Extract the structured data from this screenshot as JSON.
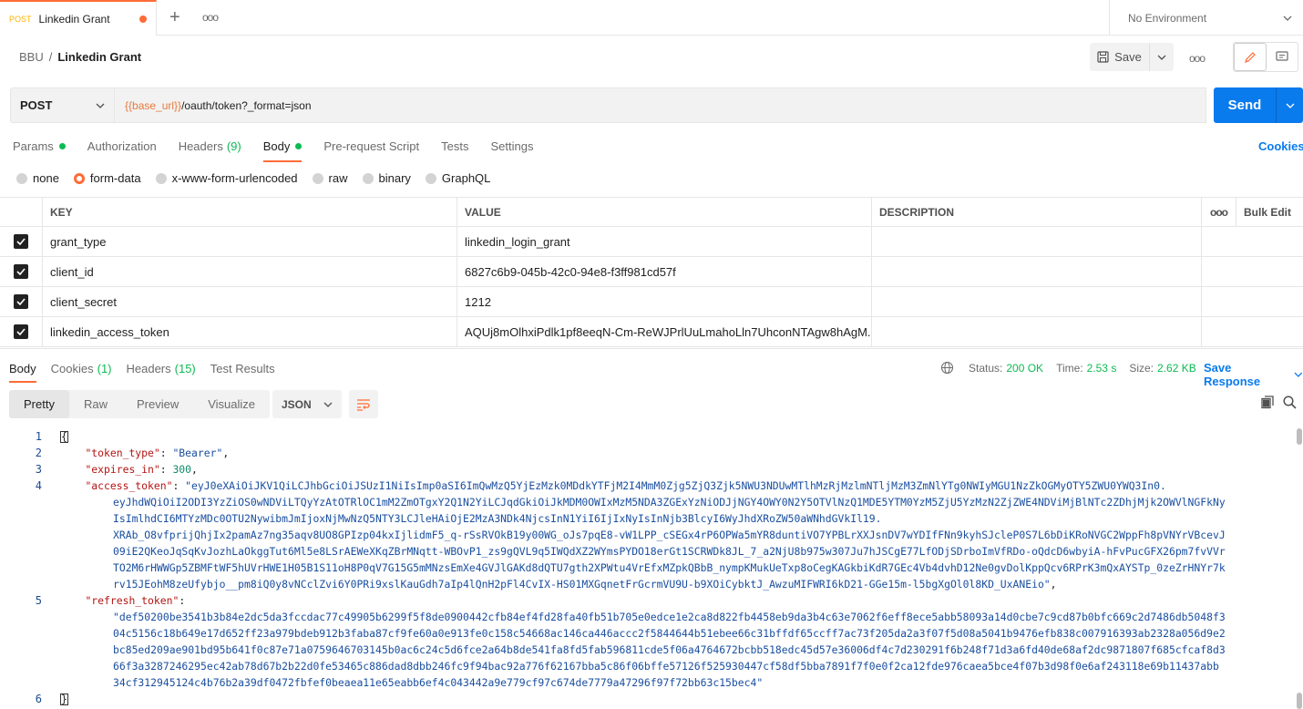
{
  "tab": {
    "method": "POST",
    "name": "Linkedin Grant",
    "unsaved": true
  },
  "environment": {
    "label": "No Environment"
  },
  "breadcrumb": {
    "collection": "BBU",
    "separator": "/",
    "request": "Linkedin Grant"
  },
  "toolbar": {
    "save_label": "Save"
  },
  "request": {
    "method": "POST",
    "url_var": "{{base_url}}",
    "url_path": "/oauth/token?_format=json",
    "send_label": "Send"
  },
  "req_tabs": {
    "params": "Params",
    "authorization": "Authorization",
    "headers": "Headers",
    "headers_count": "(9)",
    "body": "Body",
    "prerequest": "Pre-request Script",
    "tests": "Tests",
    "settings": "Settings",
    "cookies": "Cookies"
  },
  "body_types": {
    "none": "none",
    "form_data": "form-data",
    "urlencoded": "x-www-form-urlencoded",
    "raw": "raw",
    "binary": "binary",
    "graphql": "GraphQL",
    "selected": "form-data"
  },
  "table": {
    "headers": {
      "key": "KEY",
      "value": "VALUE",
      "description": "DESCRIPTION",
      "bulk_edit": "Bulk Edit"
    },
    "rows": [
      {
        "key": "grant_type",
        "value": "linkedin_login_grant",
        "checked": true
      },
      {
        "key": "client_id",
        "value": "6827c6b9-045b-42c0-94e8-f3ff981cd57f",
        "checked": true
      },
      {
        "key": "client_secret",
        "value": "1212",
        "checked": true
      },
      {
        "key": "linkedin_access_token",
        "value": "AQUj8mOlhxiPdlk1pf8eeqN-Cm-ReWJPrlUuLmahoLln7UhconNTAgw8hAgM...",
        "checked": true
      }
    ]
  },
  "response": {
    "tabs": {
      "body": "Body",
      "cookies": "Cookies",
      "cookies_count": "(1)",
      "headers": "Headers",
      "headers_count": "(15)",
      "test_results": "Test Results"
    },
    "status_label": "Status:",
    "status": "200 OK",
    "time_label": "Time:",
    "time": "2.53 s",
    "size_label": "Size:",
    "size": "2.62 KB",
    "save_response": "Save Response",
    "view_modes": {
      "pretty": "Pretty",
      "raw": "Raw",
      "preview": "Preview",
      "visualize": "Visualize"
    },
    "format": "JSON"
  },
  "code": {
    "line_numbers": [
      "1",
      "2",
      "3",
      "4",
      "5",
      "6"
    ],
    "open_brace": "{",
    "close_brace": "}",
    "token_type_key": "\"token_type\"",
    "token_type_val": "\"Bearer\"",
    "expires_in_key": "\"expires_in\"",
    "expires_in_val": "300",
    "access_token_key": "\"access_token\"",
    "access_token_lines": [
      "\"eyJ0eXAiOiJKV1QiLCJhbGciOiJSUzI1NiIsImp0aSI6ImQwMzQ5YjEzMzk0MDdkYTFjM2I4MmM0Zjg5ZjQ3Zjk5NWU3NDUwMTlhMzRjMzlmNTljMzM3ZmNlYTg0NWIyMGU1NzZkOGMyOTY5ZWU0YWQ3In0.",
      "eyJhdWQiOiI2ODI3YzZiOS0wNDViLTQyYzAtOTRlOC1mM2ZmOTgxY2Q1N2YiLCJqdGkiOiJkMDM0OWIxMzM5NDA3ZGExYzNiODJjNGY4OWY0N2Y5OTVlNzQ1MDE5YTM0YzM5ZjU5YzMzN2ZjZWE4NDViMjBlNTc2ZDhjMjk2OWVlNGFkNy",
      "IsImlhdCI6MTYzMDc0OTU2NywibmJmIjoxNjMwNzQ5NTY3LCJleHAiOjE2MzA3NDk4NjcsInN1YiI6IjIxNyIsInNjb3BlcyI6WyJhdXRoZW50aWNhdGVkIl19.",
      "XRAb_O8vfprijQhjIx2pamAz7ng35aqv8UO8GPIzp04kxIjlidmF5_q-rSsRVOkB19y00WG_oJs7pqE8-vW1LPP_cSEGx4rP6OPWa5mYR8duntiVO7YPBLrXXJsnDV7wYDIfFNn9kyhSJcleP0S7L6bDiKRoNVGC2WppFh8pVNYrVBcevJ",
      "09iE2QKeoJqSqKvJozhLaOkggTut6Ml5e8LSrAEWeXKqZBrMNqtt-WBOvP1_zs9gQVL9q5IWQdXZ2WYmsPYDO18erGt1SCRWDk8JL_7_a2NjU8b975w307Ju7hJSCgE77LfODjSDrboImVfRDo-oQdcD6wbyiA-hFvPucGFX26pm7fvVVr",
      "TO2M6rHWWGp5ZBMFtWF5hUVrHWE1H05B1S11oH8P0qV7G15G5mMNzsEmXe4GVJlGAKd8dQTU7gth2XPWtu4VrEfxMZpkQBbB_nympKMukUeTxp8oCegKAGkbiKdR7GEc4Vb4dvhD12Ne0gvDolKppQcv6RPrK3mQxAYSTp_0zeZrHNYr7k",
      "rv15JEohM8zeUfybjo__pm8iQ0y8vNCclZvi6Y0PRi9xslKauGdh7aIp4lQnH2pFl4CvIX-HS01MXGqnetFrGcrmVU9U-b9XOiCybktJ_AwzuMIFWRI6kD21-GGe15m-l5bgXgOl0l8KD_UxANEio\""
    ],
    "refresh_token_key": "\"refresh_token\"",
    "refresh_token_lines": [
      "\"def50200be3541b3b84e2dc5da3fccdac77c49905b6299f5f8de0900442cfb84ef4fd28fa40fb51b705e0edce1e2ca8d822fb4458eb9da3b4c63e7062f6eff8ece5abb58093a14d0cbe7c9cd87b0bfc669c2d7486db5048f3",
      "04c5156c18b649e17d652ff23a979bdeb912b3faba87cf9fe60a0e913fe0c158c54668ac146ca446accc2f5844644b51ebee66c31bffdf65ccff7ac73f205da2a3f07f5d08a5041b9476efb838c007916393ab2328a056d9e2",
      "bc85ed209ae901bd95b641f0c87e71a0759646703145b0ac6c24c5d6fce2a64b8de541fa8fd5fab596811cde5f06a4764672bcbb518edc45d57e36006df4c7d230291f6b248f71d3a6fd40de68af2dc9871807f685cfcaf8d3",
      "66f3a3287246295ec42ab78d67b2b22d0fe53465c886dad8dbb246fc9f94bac92a776f62167bba5c86f06bffe57126f525930447cf58df5bba7891f7f0e0f2ca12fde976caea5bce4f07b3d98f0e6af243118e69b11437abb",
      "34cf312945124c4b76b2a39df0472fbfef0beaea11e65eabb6ef4c043442a9e779cf97c674de7779a47296f97f72bb63c15bec4\""
    ]
  },
  "colors": {
    "accent": "#ff6c37",
    "primary": "#097bed",
    "success": "#0cbb52"
  }
}
